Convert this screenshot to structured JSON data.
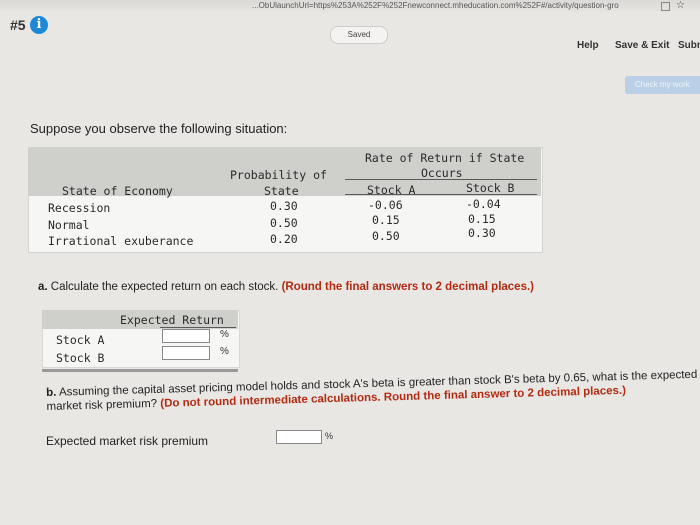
{
  "browser": {
    "url": "...ObUlaunchUrl=https%253A%252F%252Fnewconnect.mheducation.com%252F#/activity/question-gro"
  },
  "header": {
    "question_number": "#5",
    "info_icon": "i",
    "status": "Saved",
    "help_label": "Help",
    "save_exit_label": "Save & Exit",
    "submit_label": "Subm",
    "check_label": "Check my work"
  },
  "intro": "Suppose you observe the following situation:",
  "table": {
    "header_rate": "Rate of Return if State",
    "header_occurs": "Occurs",
    "header_probability": "Probability of",
    "header_state": "State",
    "header_economy": "State of Economy",
    "header_stock_a": "Stock A",
    "header_stock_b": "Stock B",
    "rows": [
      {
        "state": "Recession",
        "prob": "0.30",
        "a": "-0.06",
        "b": "-0.04"
      },
      {
        "state": "Normal",
        "prob": "0.50",
        "a": "0.15",
        "b": "0.15"
      },
      {
        "state": "Irrational exuberance",
        "prob": "0.20",
        "a": "0.50",
        "b": "0.30"
      }
    ]
  },
  "part_a": {
    "prefix": "a.",
    "text": " Calculate the expected return on each stock. ",
    "instruction": "(Round the final answers to 2 decimal places.)",
    "table_header": "Expected Return",
    "rows": [
      {
        "label": "Stock A",
        "unit": "%",
        "value": ""
      },
      {
        "label": "Stock B",
        "unit": "%",
        "value": ""
      }
    ]
  },
  "part_b": {
    "prefix": "b.",
    "text": " Assuming the capital asset pricing model holds and stock A's beta is greater than stock B's beta by 0.65, what is the expected market risk premium? ",
    "instruction": "(Do not round intermediate calculations. Round the final answer to 2 decimal places.)",
    "answer_label": "Expected market risk premium",
    "unit": "%",
    "value": ""
  },
  "colors": {
    "accent": "#1e88d8",
    "instruction": "#b52a10",
    "table_header": "#cfcfcc"
  }
}
